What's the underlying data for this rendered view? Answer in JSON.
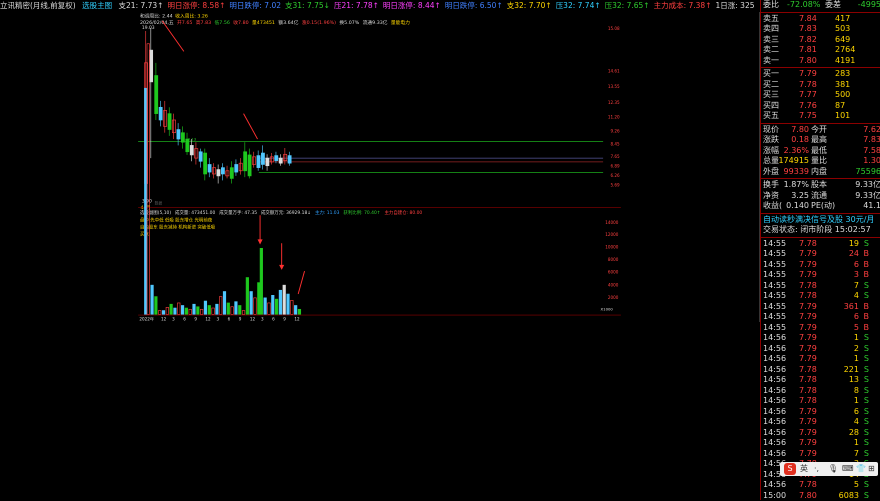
{
  "topbar": {
    "title": "立讯精密(月线,前复权)",
    "icon_label": "选股主图",
    "items": [
      {
        "t": "支21: 7.73↑",
        "c": "c-w"
      },
      {
        "t": "明日涨停: 8.58↑",
        "c": "c-r"
      },
      {
        "t": "明日跌停: 7.02",
        "c": "c-b"
      },
      {
        "t": "支31: 7.75↓",
        "c": "c-g"
      },
      {
        "t": "压21: 7.78↑",
        "c": "c-m"
      },
      {
        "t": "明日涨停: 8.44↑",
        "c": "c-m"
      },
      {
        "t": "明日跌停: 6.50↑",
        "c": "c-b"
      },
      {
        "t": "支32: 7.70↑",
        "c": "c-y"
      },
      {
        "t": "压32: 7.74↑",
        "c": "c-c"
      },
      {
        "t": "压32: 7.65↑",
        "c": "c-g"
      },
      {
        "t": "主力成本: 7.38↑",
        "c": "c-r"
      },
      {
        "t": "1日涨: 325.74",
        "c": "c-w"
      }
    ]
  },
  "line2": {
    "a": "和调周比: 2.44",
    "b": "收入周比: 3.26"
  },
  "line3": {
    "date": "2026/02/04,五",
    "open": "开7.65",
    "high": "高7.83",
    "low": "低7.56",
    "close": "收7.80",
    "vol": "量473451",
    "amt": "额3.64亿",
    "chg": "涨0.15(1.96%)",
    "turn": "换5.07%",
    "flow": "流通9.33亿",
    "tag": "量能电力"
  },
  "main_chart": {
    "high_label": "19.03",
    "low_label": "3.90",
    "month_label": "44月",
    "watermark": "数据",
    "box_label": "4.13",
    "axis": [
      "15.08",
      "14.61",
      "13.55",
      "12.35",
      "11.20",
      "9.26",
      "8.45",
      "7.65",
      "6.89",
      "6.26",
      "5.69"
    ]
  },
  "lower": {
    "title": "选股副图(5,10)",
    "vol": "成交量: 473451.00",
    "amt": "成交量万手: 47.35",
    "amt2": "成交额万元: 36929.18↓",
    "red": "主力: 11.03",
    "green": "获利比例: 70.40↑",
    "yellow": "主力自建仓: 80.00",
    "legend1": "盘中 先中低 低吸 股东增仓 光明前夜",
    "legend2": "自由股东 股东减持 机构新进 突破低吸",
    "legend3": "买点",
    "axis": [
      "14000",
      "12000",
      "10000",
      "8000",
      "6000",
      "4000",
      "2000"
    ],
    "x1000": "X1000"
  },
  "xaxis": {
    "year": "2022年",
    "ticks": [
      "12",
      "3",
      "6",
      "9",
      "12",
      "3",
      "6",
      "9",
      "12",
      "3",
      "6",
      "9",
      "12"
    ]
  },
  "right": {
    "header": {
      "wb": "委比",
      "wb_v": "-72.08%",
      "wc": "委差",
      "wc_v": "-4995"
    },
    "asks": [
      {
        "l": "卖五",
        "p": "7.84",
        "v": "417"
      },
      {
        "l": "卖四",
        "p": "7.83",
        "v": "503"
      },
      {
        "l": "卖三",
        "p": "7.82",
        "v": "649"
      },
      {
        "l": "卖二",
        "p": "7.81",
        "v": "2764"
      },
      {
        "l": "卖一",
        "p": "7.80",
        "v": "4191"
      }
    ],
    "bids": [
      {
        "l": "买一",
        "p": "7.79",
        "v": "283"
      },
      {
        "l": "买二",
        "p": "7.78",
        "v": "381"
      },
      {
        "l": "买三",
        "p": "7.77",
        "v": "500"
      },
      {
        "l": "买四",
        "p": "7.76",
        "v": "87"
      },
      {
        "l": "买五",
        "p": "7.75",
        "v": "101"
      }
    ],
    "stats": [
      {
        "a": "现价",
        "b": "7.80",
        "c": "今开",
        "d": "7.62"
      },
      {
        "a": "涨跌",
        "b": "0.18",
        "c": "最高",
        "d": "7.83"
      },
      {
        "a": "涨幅",
        "b": "2.36%",
        "c": "最低",
        "d": "7.58"
      },
      {
        "a": "总量",
        "b": "174915",
        "c": "量比",
        "d": "1.30"
      },
      {
        "a": "外盘",
        "b": "99339",
        "c": "内盘",
        "d": "75596"
      }
    ],
    "stats2": [
      {
        "a": "换手",
        "b": "1.87%",
        "c": "股本",
        "d": "9.33亿"
      },
      {
        "a": "净资",
        "b": "3.25",
        "c": "流通",
        "d": "9.33亿"
      },
      {
        "a": "收益(",
        "b": "0.140",
        "c": "PE(动)",
        "d": "41.1"
      }
    ],
    "notice": "自动读秒满决信号及股    30元/月",
    "status": "交易状态: 闭市阶段 15:02:57",
    "ticks": [
      {
        "t": "14:55",
        "p": "7.78",
        "v": "19",
        "s": "S"
      },
      {
        "t": "14:55",
        "p": "7.79",
        "v": "24",
        "s": "B"
      },
      {
        "t": "14:55",
        "p": "7.79",
        "v": "6",
        "s": "B"
      },
      {
        "t": "14:55",
        "p": "7.79",
        "v": "3",
        "s": "B"
      },
      {
        "t": "14:55",
        "p": "7.78",
        "v": "7",
        "s": "S"
      },
      {
        "t": "14:55",
        "p": "7.78",
        "v": "4",
        "s": "S"
      },
      {
        "t": "14:55",
        "p": "7.79",
        "v": "361",
        "s": "B"
      },
      {
        "t": "14:55",
        "p": "7.79",
        "v": "6",
        "s": "B"
      },
      {
        "t": "14:55",
        "p": "7.79",
        "v": "5",
        "s": "B"
      },
      {
        "t": "14:56",
        "p": "7.79",
        "v": "1",
        "s": "S"
      },
      {
        "t": "14:56",
        "p": "7.79",
        "v": "2",
        "s": "S"
      },
      {
        "t": "14:56",
        "p": "7.79",
        "v": "1",
        "s": "S"
      },
      {
        "t": "14:56",
        "p": "7.78",
        "v": "221",
        "s": "S"
      },
      {
        "t": "14:56",
        "p": "7.78",
        "v": "13",
        "s": "S"
      },
      {
        "t": "14:56",
        "p": "7.78",
        "v": "8",
        "s": "S"
      },
      {
        "t": "14:56",
        "p": "7.78",
        "v": "1",
        "s": "S"
      },
      {
        "t": "14:56",
        "p": "7.79",
        "v": "6",
        "s": "S"
      },
      {
        "t": "14:56",
        "p": "7.79",
        "v": "4",
        "s": "S"
      },
      {
        "t": "14:56",
        "p": "7.79",
        "v": "28",
        "s": "S"
      },
      {
        "t": "14:56",
        "p": "7.79",
        "v": "1",
        "s": "S"
      },
      {
        "t": "14:56",
        "p": "7.79",
        "v": "7",
        "s": "S"
      },
      {
        "t": "14:56",
        "p": "7.78",
        "v": "3",
        "s": "S"
      },
      {
        "t": "14:56",
        "p": "7.79",
        "v": "14",
        "s": "S"
      },
      {
        "t": "14:56",
        "p": "7.78",
        "v": "5",
        "s": "S"
      },
      {
        "t": "15:00",
        "p": "7.80",
        "v": "6083",
        "s": "S"
      }
    ],
    "price_axis": [
      "7.86",
      "4193",
      "5",
      "7.85",
      "7.84",
      "7.83",
      "6083"
    ],
    "footer": "百度"
  },
  "tray": {
    "label": "英",
    "icons": [
      "·,",
      "mic",
      "keyboard",
      "shirt",
      "grid"
    ]
  }
}
